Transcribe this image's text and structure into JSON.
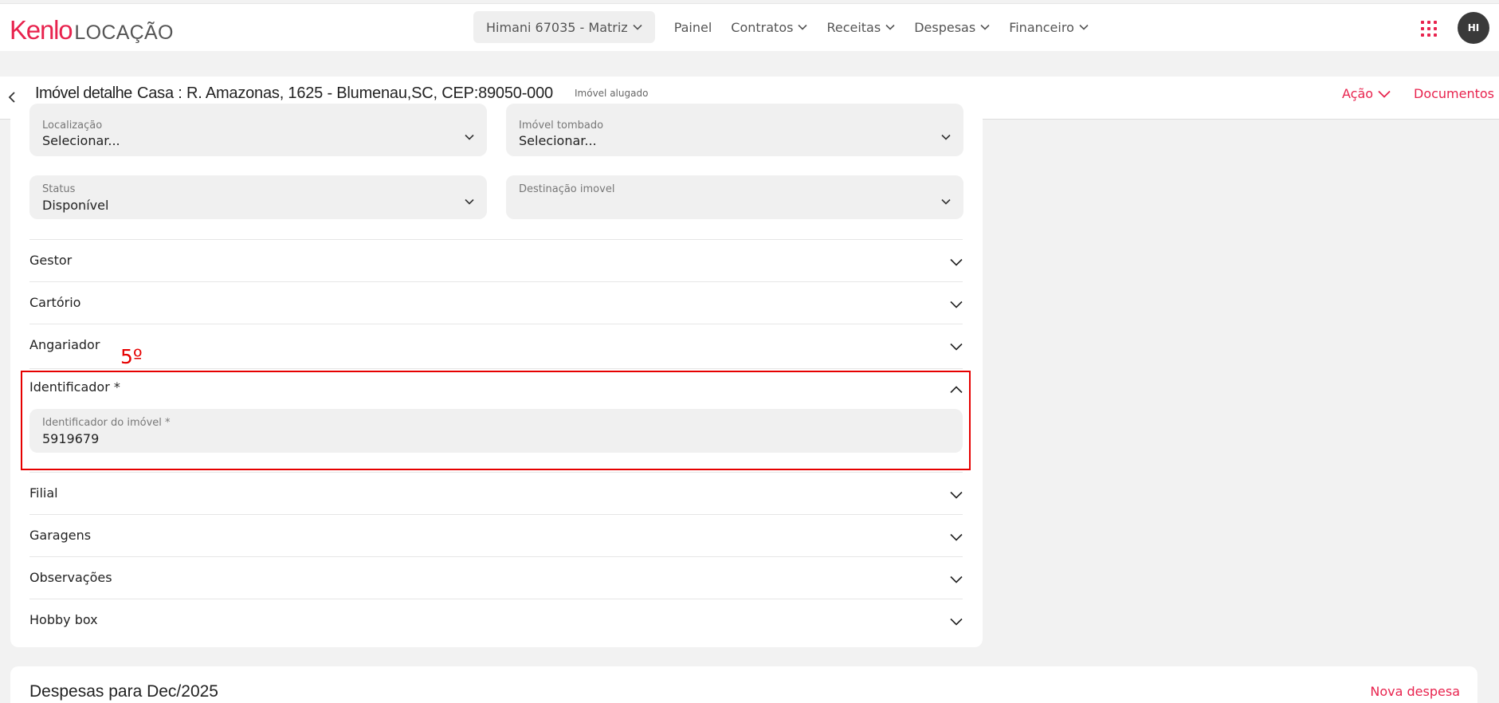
{
  "brand": {
    "logo_main": "Kenlo",
    "logo_sub": "LOCAÇÃO",
    "accent": "#e8234e"
  },
  "nav": {
    "org_selector": "Himani 67035 - Matriz",
    "items": [
      "Painel",
      "Contratos",
      "Receitas",
      "Despesas",
      "Financeiro"
    ]
  },
  "user": {
    "initials": "HI"
  },
  "header": {
    "title": "Imóvel detalhe",
    "address": "Casa : R. Amazonas, 1625 - Blumenau,SC, CEP:89050-000",
    "status": "Imóvel alugado",
    "action_label": "Ação",
    "documents_label": "Documentos"
  },
  "form": {
    "localizacao": {
      "label": "Localização",
      "value": "Selecionar..."
    },
    "imovel_tombado": {
      "label": "Imóvel tombado",
      "value": "Selecionar..."
    },
    "status": {
      "label": "Status",
      "value": "Disponível"
    },
    "destinacao": {
      "label": "Destinação imovel",
      "value": ""
    }
  },
  "sections": {
    "gestor": "Gestor",
    "cartorio": "Cartório",
    "angariador": "Angariador",
    "identificador": "Identificador *",
    "filial": "Filial",
    "garagens": "Garagens",
    "observacoes": "Observações",
    "hobby_box": "Hobby box"
  },
  "identificador": {
    "field_label": "Identificador do imóvel *",
    "field_value": "5919679"
  },
  "annotation": {
    "label": "5º",
    "color": "#e60000"
  },
  "despesas": {
    "title": "Despesas para Dec/2025",
    "new_label": "Nova despesa"
  }
}
